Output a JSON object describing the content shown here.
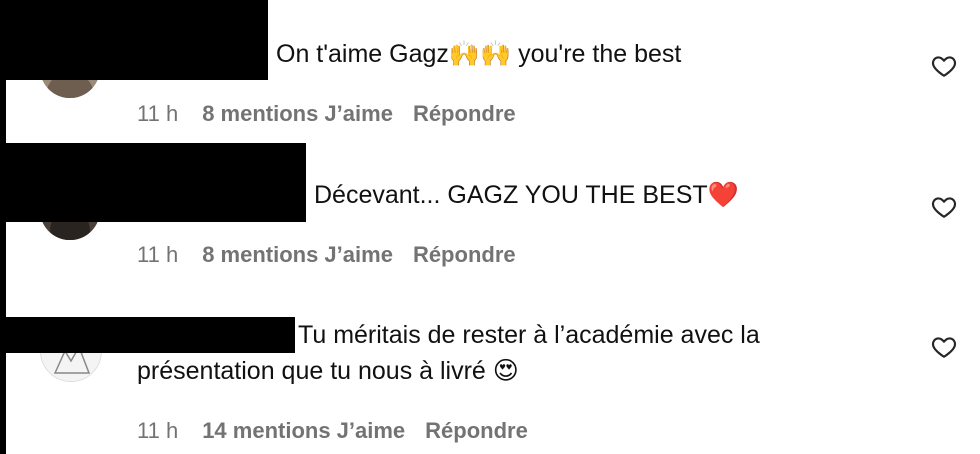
{
  "comments": [
    {
      "text": "On t'aime Gagz",
      "emoji": "🙌🙌",
      "text_after": " you're the best",
      "time": "11 h",
      "likes": "8 mentions J’aime",
      "reply": "Répondre",
      "avatar_icon": "user-avatar-icon",
      "like_icon": "heart-icon"
    },
    {
      "text": "Décevant... GAGZ YOU THE BEST",
      "emoji": "❤️",
      "time": "11 h",
      "likes": "8 mentions J’aime",
      "reply": "Répondre",
      "avatar_icon": "user-avatar-icon",
      "like_icon": "heart-icon"
    },
    {
      "text_line1": "Tu méritais de rester à l’académie avec la",
      "text_line2": "présentation que tu nous à livré",
      "emoji": "😍",
      "time": "11 h",
      "likes": "14 mentions J’aime",
      "reply": "Répondre",
      "avatar_icon": "user-avatar-icon",
      "like_icon": "heart-icon"
    }
  ],
  "colors": {
    "text": "#111111",
    "meta": "#737373",
    "redaction": "#000000"
  }
}
